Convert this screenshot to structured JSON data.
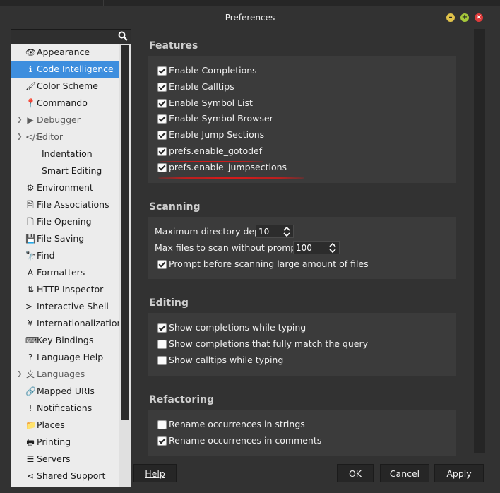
{
  "window": {
    "title": "Preferences"
  },
  "sidebar": {
    "items": [
      {
        "label": "Appearance",
        "icon": "eye-icon",
        "glyph": "👁",
        "state": "normal"
      },
      {
        "label": "Code Intelligence",
        "icon": "info-icon",
        "glyph": "ℹ",
        "state": "selected"
      },
      {
        "label": "Color Scheme",
        "icon": "brush-icon",
        "glyph": "🖌",
        "state": "normal"
      },
      {
        "label": "Commando",
        "icon": "pin-icon",
        "glyph": "📍",
        "state": "normal"
      },
      {
        "label": "Debugger",
        "icon": "play-icon",
        "glyph": "▶",
        "state": "dim",
        "expand": true
      },
      {
        "label": "Editor",
        "icon": "code-icon",
        "glyph": "</>",
        "state": "dim",
        "expand": true
      },
      {
        "label": "Indentation",
        "icon": "",
        "glyph": "",
        "state": "sub"
      },
      {
        "label": "Smart Editing",
        "icon": "",
        "glyph": "",
        "state": "sub"
      },
      {
        "label": "Environment",
        "icon": "gear-icon",
        "glyph": "⚙",
        "state": "normal"
      },
      {
        "label": "File Associations",
        "icon": "file-link-icon",
        "glyph": "🗎",
        "state": "normal"
      },
      {
        "label": "File Opening",
        "icon": "file-open-icon",
        "glyph": "🗋",
        "state": "normal"
      },
      {
        "label": "File Saving",
        "icon": "save-icon",
        "glyph": "💾",
        "state": "normal"
      },
      {
        "label": "Find",
        "icon": "binoculars-icon",
        "glyph": "🔭",
        "state": "normal"
      },
      {
        "label": "Formatters",
        "icon": "font-icon",
        "glyph": "A",
        "state": "normal"
      },
      {
        "label": "HTTP Inspector",
        "icon": "inspector-icon",
        "glyph": "⇅",
        "state": "normal"
      },
      {
        "label": "Interactive Shell",
        "icon": "terminal-icon",
        "glyph": ">_",
        "state": "normal"
      },
      {
        "label": "Internationalization",
        "icon": "yen-icon",
        "glyph": "¥",
        "state": "normal"
      },
      {
        "label": "Key Bindings",
        "icon": "keyboard-icon",
        "glyph": "⌨",
        "state": "normal"
      },
      {
        "label": "Language Help",
        "icon": "help-icon",
        "glyph": "?",
        "state": "normal"
      },
      {
        "label": "Languages",
        "icon": "languages-icon",
        "glyph": "文",
        "state": "dim",
        "expand": true
      },
      {
        "label": "Mapped URIs",
        "icon": "link-icon",
        "glyph": "🔗",
        "state": "normal"
      },
      {
        "label": "Notifications",
        "icon": "alert-icon",
        "glyph": "!",
        "state": "normal"
      },
      {
        "label": "Places",
        "icon": "folder-icon",
        "glyph": "📁",
        "state": "normal"
      },
      {
        "label": "Printing",
        "icon": "printer-icon",
        "glyph": "🖶",
        "state": "normal"
      },
      {
        "label": "Servers",
        "icon": "server-icon",
        "glyph": "☰",
        "state": "normal"
      },
      {
        "label": "Shared Support",
        "icon": "share-icon",
        "glyph": "⋖",
        "state": "normal"
      }
    ]
  },
  "features": {
    "title": "Features",
    "options": [
      {
        "label": "Enable Completions",
        "checked": true
      },
      {
        "label": "Enable Calltips",
        "checked": true
      },
      {
        "label": "Enable Symbol List",
        "checked": true
      },
      {
        "label": "Enable Symbol Browser",
        "checked": true
      },
      {
        "label": "Enable Jump Sections",
        "checked": true
      },
      {
        "label": "prefs.enable_gotodef",
        "checked": true
      },
      {
        "label": "prefs.enable_jumpsections",
        "checked": true
      }
    ]
  },
  "scanning": {
    "title": "Scanning",
    "depth_label": "Maximum directory depth:",
    "depth_value": "10",
    "maxfiles_label": "Max files to scan without prompting:",
    "maxfiles_value": "100",
    "prompt_label": "Prompt before scanning large amount of files",
    "prompt_checked": true
  },
  "editing": {
    "title": "Editing",
    "options": [
      {
        "label": "Show completions while typing",
        "checked": true
      },
      {
        "label": "Show completions that fully match the query",
        "checked": false
      },
      {
        "label": "Show calltips while typing",
        "checked": false
      }
    ]
  },
  "refactoring": {
    "title": "Refactoring",
    "options": [
      {
        "label": "Rename occurrences in strings",
        "checked": false
      },
      {
        "label": "Rename occurrences in comments",
        "checked": true
      }
    ]
  },
  "buttons": {
    "help": "Help",
    "ok": "OK",
    "cancel": "Cancel",
    "apply": "Apply"
  },
  "colors": {
    "selection": "#3d8ede",
    "annotation": "#d21b1b"
  }
}
